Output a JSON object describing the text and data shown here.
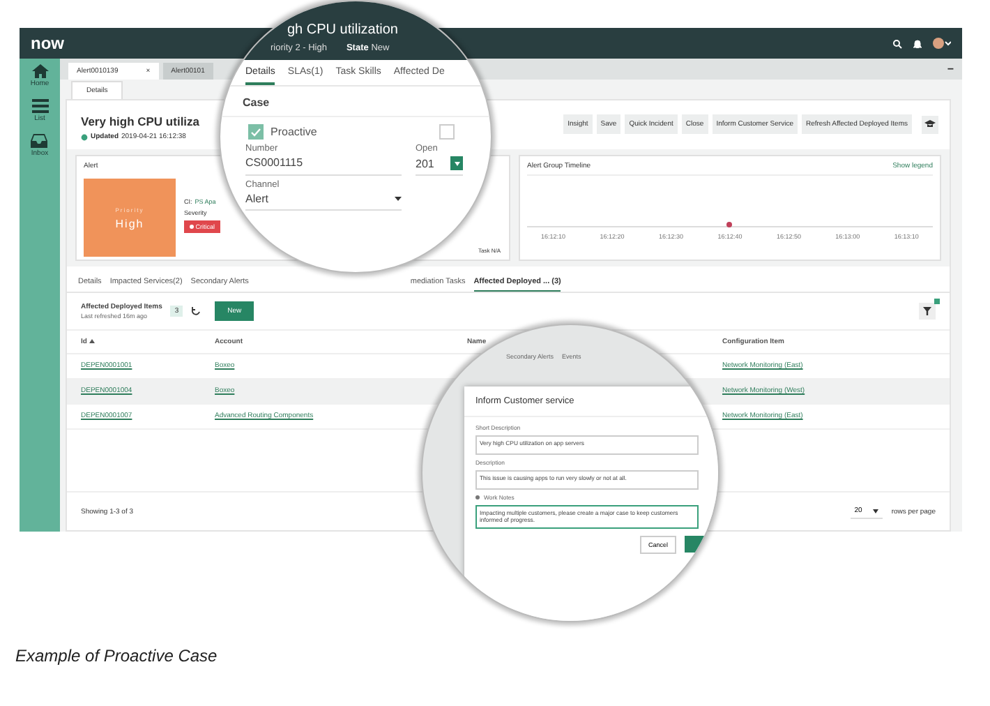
{
  "top_bar": {
    "logo": "now"
  },
  "sidebar": {
    "items": [
      {
        "label": "Home",
        "kind": "home"
      },
      {
        "label": "List",
        "kind": "list"
      },
      {
        "label": "Inbox",
        "kind": "inbox"
      }
    ]
  },
  "tabs": [
    {
      "label": "Alert0010139",
      "close": "×",
      "selected": true
    },
    {
      "label": "Alert00101",
      "selected": false
    }
  ],
  "minimize": "−",
  "subtab": "Details",
  "record": {
    "title": "Very high CPU utiliza",
    "updated_label": "Updated",
    "updated": "2019-04-21 16:12:38"
  },
  "actions": [
    "Insight",
    "Save",
    "Quick Incident",
    "Close",
    "Inform Customer Service",
    "Refresh Affected Deployed Items"
  ],
  "alert_card": {
    "title": "Alert",
    "priority_label": "Priority",
    "priority": "High",
    "ci_label": "CI:",
    "ci": "PS Apa",
    "severity_label": "Severity",
    "severity": "Critical",
    "task": "Task N/A"
  },
  "timeline": {
    "title": "Alert Group Timeline",
    "legend_link": "Show legend",
    "ticks": [
      {
        "label": "16:12:10",
        "event": false
      },
      {
        "label": "16:12:20",
        "event": false
      },
      {
        "label": "16:12:30",
        "event": false
      },
      {
        "label": "16:12:40",
        "event": true
      },
      {
        "label": "16:12:50",
        "event": false
      },
      {
        "label": "16:13:00",
        "event": false
      },
      {
        "label": "16:13:10",
        "event": false
      }
    ]
  },
  "detail_tabs": [
    {
      "label": "Details",
      "selected": false
    },
    {
      "label": "Impacted Services(2)",
      "selected": false
    },
    {
      "label": "Secondary Alerts",
      "selected": false
    },
    {
      "label": "mediation Tasks",
      "selected": false
    },
    {
      "label": "Affected Deployed ... (3)",
      "selected": true
    }
  ],
  "list": {
    "title": "Affected Deployed Items",
    "count": "3",
    "refreshed": "Last refreshed 16m ago",
    "new_button": "New"
  },
  "table": {
    "columns": [
      {
        "label": "Id",
        "sorted": true
      },
      {
        "label": "Account",
        "sorted": false
      },
      {
        "label": "Name",
        "sorted": false
      },
      {
        "label": "Configuration Item",
        "sorted": false
      }
    ],
    "rows": [
      {
        "id": "DEPEN0001001",
        "account": "Boxeo",
        "config": "Network Monitoring (East)",
        "selected": false
      },
      {
        "id": "DEPEN0001004",
        "account": "Boxeo",
        "config": "Network Monitoring (West)",
        "selected": true
      },
      {
        "id": "DEPEN0001007",
        "account": "Advanced Routing Components",
        "config": "Network Monitoring (East)",
        "selected": false
      }
    ]
  },
  "footer": {
    "showing": "Showing 1-3 of 3",
    "page_size": "20",
    "rows_label": "rows per page"
  },
  "zoom_case": {
    "heading": "gh CPU utilization",
    "priority": "riority 2 - High",
    "state_label": "State",
    "state": "New",
    "tabs": [
      {
        "label": "Details",
        "selected": true
      },
      {
        "label": "SLAs(1)",
        "selected": false
      },
      {
        "label": "Task Skills",
        "selected": false
      },
      {
        "label": "Affected De",
        "selected": false
      }
    ],
    "section": "Case",
    "checkboxes": [
      {
        "label": "Proactive",
        "checked": true
      },
      {
        "checked": false
      }
    ],
    "fields": [
      {
        "label": "Number",
        "value": "CS0001115",
        "kind": "text"
      },
      {
        "label": "Open",
        "value": "201",
        "kind": "date"
      },
      {
        "label": "Channel",
        "value": "Alert",
        "kind": "select"
      }
    ]
  },
  "zoom_dialog": {
    "background_tabs": [
      "Secondary Alerts",
      "Events"
    ],
    "title": "Inform Customer service",
    "fields": [
      {
        "label": "Short Description",
        "value": "Very high CPU utilization on app servers",
        "active": false
      },
      {
        "label": "Description",
        "value": "This issue is causing apps to run very slowly or not at all.",
        "active": false
      },
      {
        "label": "Work Notes",
        "value": "Impacting multiple customers, please create a major case to keep customers informed of progress.",
        "active": true
      }
    ],
    "cancel": "Cancel"
  },
  "caption": "Example of Proactive Case"
}
